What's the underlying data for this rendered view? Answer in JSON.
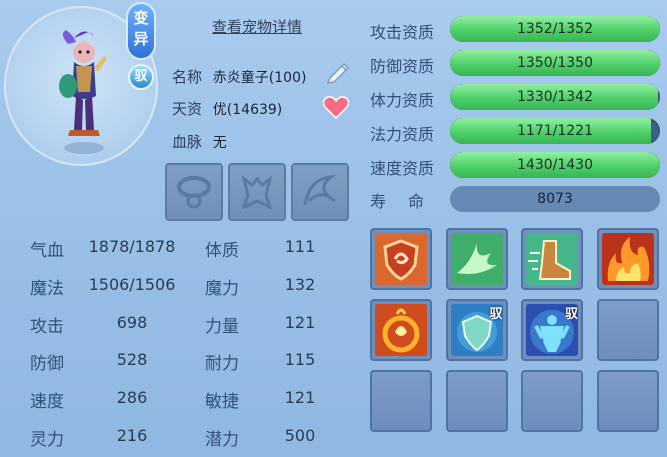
{
  "header": {
    "detail_link": "查看宠物详情",
    "mutation_badge_top": "变",
    "mutation_badge_bottom": "异",
    "tame_badge": "驭"
  },
  "pet": {
    "name_label": "名称",
    "name_value": "赤炎童子(100)",
    "talent_label": "天资",
    "talent_value": "优(14639)",
    "bloodline_label": "血脉",
    "bloodline_value": "无"
  },
  "left_stats": [
    {
      "label": "气血",
      "value": "1878/1878"
    },
    {
      "label": "魔法",
      "value": "1506/1506"
    },
    {
      "label": "攻击",
      "value": "698"
    },
    {
      "label": "防御",
      "value": "528"
    },
    {
      "label": "速度",
      "value": "286"
    },
    {
      "label": "灵力",
      "value": "216"
    }
  ],
  "right_stats": [
    {
      "label": "体质",
      "value": "111"
    },
    {
      "label": "魔力",
      "value": "132"
    },
    {
      "label": "力量",
      "value": "121"
    },
    {
      "label": "耐力",
      "value": "115"
    },
    {
      "label": "敏捷",
      "value": "121"
    },
    {
      "label": "潜力",
      "value": "500"
    }
  ],
  "aptitudes": [
    {
      "label": "攻击资质",
      "text": "1352/1352",
      "fraction": 1.0
    },
    {
      "label": "防御资质",
      "text": "1350/1350",
      "fraction": 1.0
    },
    {
      "label": "体力资质",
      "text": "1330/1342",
      "fraction": 0.991
    },
    {
      "label": "法力资质",
      "text": "1171/1221",
      "fraction": 0.959
    },
    {
      "label": "速度资质",
      "text": "1430/1430",
      "fraction": 1.0
    }
  ],
  "lifespan": {
    "label": "寿命",
    "value": "8073"
  },
  "skills": [
    {
      "icon": "shield-swirl-skill-icon"
    },
    {
      "icon": "wings-skill-icon"
    },
    {
      "icon": "boot-skill-icon"
    },
    {
      "icon": "flame-skill-icon"
    },
    {
      "icon": "fire-ring-skill-icon"
    },
    {
      "icon": "guard-shield-skill-icon",
      "mark": "驭"
    },
    {
      "icon": "muscle-figure-skill-icon",
      "mark": "驭"
    },
    {
      "icon": "empty"
    },
    {
      "icon": "empty"
    },
    {
      "icon": "empty"
    },
    {
      "icon": "empty"
    },
    {
      "icon": "empty"
    }
  ],
  "colors": {
    "bar_fill": "#4fcf69",
    "bar_bg": "#3d5f86",
    "panel_bg": "#9cc2e8"
  }
}
